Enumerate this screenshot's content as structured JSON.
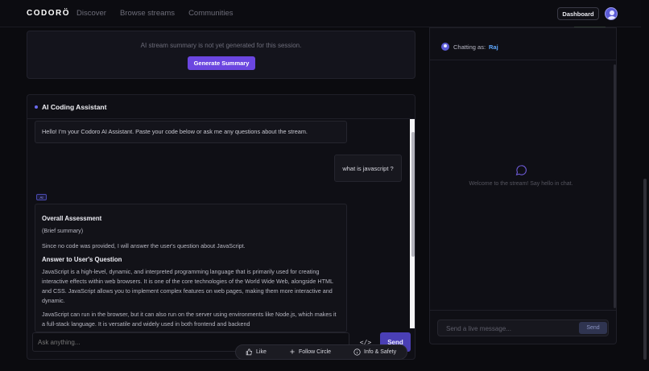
{
  "header": {
    "logo": "CODORÖ",
    "nav": [
      "Discover",
      "Browse streams",
      "Communities"
    ],
    "dashboard_label": "Dashboard"
  },
  "summary": {
    "message": "AI stream summary is not yet generated for this session.",
    "button_label": "Generate Summary"
  },
  "assistant": {
    "title": "AI Coding Assistant",
    "greeting": "Hello! I'm your Codoro AI Assistant. Paste your code below or ask me any questions about the stream.",
    "user_question": "what is javascript ?",
    "ai_tag": "AI",
    "response": {
      "h1": "Overall Assessment",
      "brief": "(Brief summary)",
      "p1": "Since no code was provided, I will answer the user's question about JavaScript.",
      "h2": "Answer to User's Question",
      "p2": "JavaScript is a high-level, dynamic, and interpreted programming language that is primarily used for creating interactive effects within web browsers. It is one of the core technologies of the World Wide Web, alongside HTML and CSS. JavaScript allows you to implement complex features on web pages, making them more interactive and dynamic.",
      "p3": "JavaScript can run in the browser, but it can also run on the server using environments like Node.js, which makes it a full-stack language. It is versatile and widely used in both frontend and backend"
    },
    "input_placeholder": "Ask anything...",
    "code_button": "</>",
    "send_label": "Send"
  },
  "actions": {
    "like": "Like",
    "follow": "Follow Circle",
    "info": "Info & Safety"
  },
  "chat": {
    "chatting_as_label": "Chatting as:",
    "username": "Raj",
    "welcome": "Welcome to the stream! Say hello in chat.",
    "input_placeholder": "Send a live message...",
    "send_label": "Send"
  },
  "colors": {
    "accent": "#6b46e0",
    "username": "#5fa8ff",
    "background": "#0b0b0f"
  }
}
